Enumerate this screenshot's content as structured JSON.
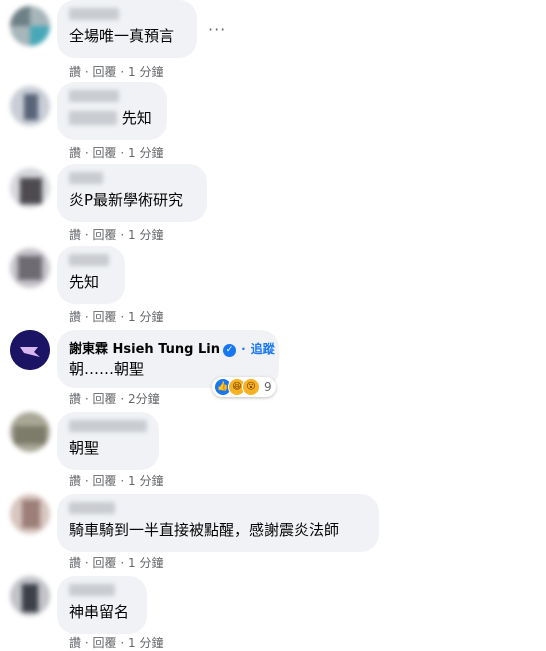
{
  "meta_actions": {
    "like": "讚",
    "reply": "回覆",
    "sep": "·"
  },
  "comments": [
    {
      "text": "全場唯一真預言",
      "time": "1 分鐘"
    },
    {
      "text": "先知",
      "time": "1 分鐘"
    },
    {
      "text": "炎P最新學術研究",
      "time": "1 分鐘"
    },
    {
      "text": "先知",
      "time": "1 分鐘"
    },
    {
      "author": "謝東霖 Hsieh Tung Lin",
      "follow": "追蹤",
      "text": "朝……朝聖",
      "time": "2分鐘",
      "reactions_count": "9",
      "reaction_icons": [
        "like-icon",
        "haha-icon",
        "wow-icon"
      ]
    },
    {
      "text": "朝聖",
      "time": "1 分鐘"
    },
    {
      "text": "騎車騎到一半直接被點醒，感謝震炎法師",
      "time": "1 分鐘"
    },
    {
      "text": "神串留名",
      "time": "1 分鐘"
    }
  ],
  "more_glyph": "···",
  "colors": {
    "bubble": "#f0f2f5",
    "link": "#1877f2",
    "meta": "#65676b"
  }
}
